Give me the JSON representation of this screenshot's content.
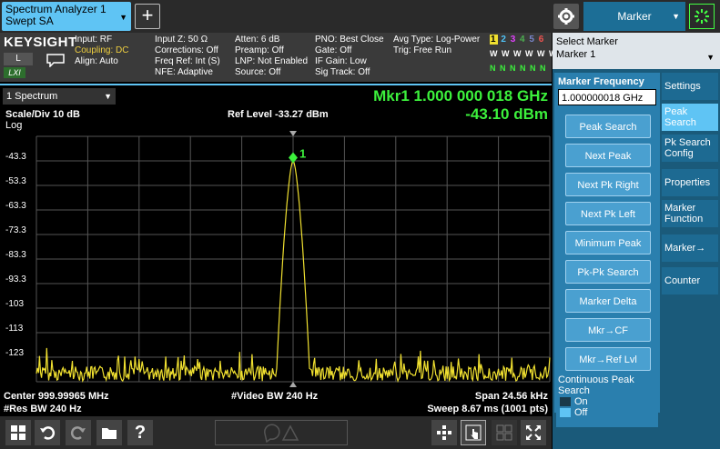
{
  "tab": {
    "line1": "Spectrum Analyzer 1",
    "line2": "Swept SA"
  },
  "menu": {
    "title": "Marker"
  },
  "brand": "KEYSIGHT",
  "badges": {
    "l": "L",
    "lxi": "LXI"
  },
  "info": {
    "col1": [
      "Input: RF",
      "Coupling: DC",
      "Align: Auto"
    ],
    "col2": [
      "Input Z: 50 Ω",
      "Corrections: Off",
      "Freq Ref: Int (S)",
      "NFE: Adaptive"
    ],
    "col3": [
      "Atten: 6 dB",
      "Preamp: Off",
      "LNP: Not Enabled",
      "Source: Off"
    ],
    "col4": [
      "PNO: Best Close",
      "Gate: Off",
      "IF Gain: Low",
      "Sig Track: Off"
    ],
    "col5": [
      "Avg Type: Log-Power",
      "Trig: Free Run"
    ],
    "traces": {
      "numbers": [
        "1",
        "2",
        "3",
        "4",
        "5",
        "6"
      ],
      "types": "W W W W W W",
      "detectors": "N N N N N N"
    }
  },
  "screen": {
    "selector": "1 Spectrum",
    "marker_readout": "Mkr1  1.000 000 018 GHz",
    "marker_amplitude": "-43.10 dBm",
    "scale": "Scale/Div 10 dB",
    "ref_level": "Ref Level -33.27 dBm",
    "log": "Log",
    "marker_label": "1",
    "center": "Center 999.99965 MHz",
    "res_bw": "#Res BW 240 Hz",
    "video_bw": "#Video BW 240 Hz",
    "span": "Span 24.56 kHz",
    "sweep": "Sweep 8.67 ms (1001 pts)"
  },
  "right_panel": {
    "select_marker_label": "Select Marker",
    "select_marker_value": "Marker 1",
    "marker_freq_label": "Marker Frequency",
    "marker_freq_value": "1.000000018 GHz",
    "buttons": [
      "Peak Search",
      "Next Peak",
      "Next Pk Right",
      "Next Pk Left",
      "Minimum Peak",
      "Pk-Pk Search",
      "Marker Delta",
      "Mkr→CF",
      "Mkr→Ref Lvl"
    ],
    "continuous_peak": {
      "label": "Continuous Peak Search",
      "on": "On",
      "off": "Off"
    },
    "tabs": [
      "Settings",
      "Peak Search",
      "Pk Search Config",
      "Properties",
      "Marker Function",
      "Marker→",
      "Counter"
    ]
  },
  "colors": {
    "accent": "#5fc4f4",
    "trace": "#f0e030",
    "marker": "#3cf03c",
    "panel": "#1a5a7a"
  },
  "chart_data": {
    "type": "line",
    "ylabel_ticks": [
      "-43.3",
      "-53.3",
      "-63.3",
      "-73.3",
      "-83.3",
      "-93.3",
      "-103",
      "-113",
      "-123"
    ],
    "ylim": [
      -133.27,
      -33.27
    ],
    "xlim_khz": [
      -12.28,
      12.28
    ],
    "peak": {
      "x_khz": 0.0,
      "y": -43.1
    },
    "noise_floor": -127
  }
}
